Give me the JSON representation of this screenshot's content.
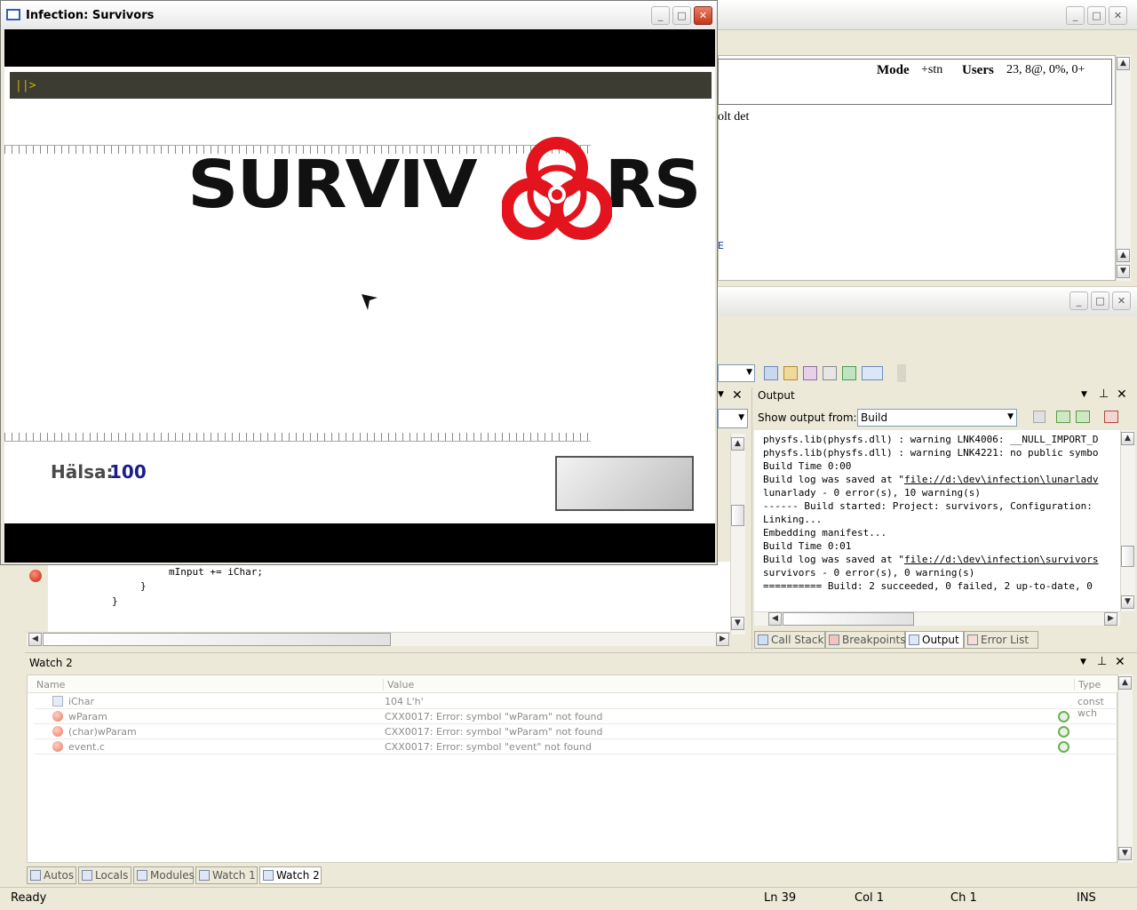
{
  "game_window": {
    "title": "Infection: Survivors",
    "console_prompt": "||>",
    "logo_text": "SURVIV",
    "logo_text_end": "RS",
    "health_label": "Hälsa:",
    "health_value": "100"
  },
  "irc_panel": {
    "mode_label": "Mode",
    "mode_value": "+stn",
    "users_label": "Users",
    "users_value": "23, 8@, 0%, 0+",
    "chat_fragment": "olt det",
    "fragment_2": "E"
  },
  "code_editor": {
    "lines": [
      "mInput += iChar;",
      "}",
      "}"
    ]
  },
  "output_panel": {
    "title": "Output",
    "show_from_label": "Show output from:",
    "show_from_value": "Build",
    "lines": [
      "physfs.lib(physfs.dll) : warning LNK4006: __NULL_IMPORT_D",
      "physfs.lib(physfs.dll) : warning LNK4221: no public symbo",
      "Build Time 0:00",
      "Build log was saved at \"file://d:\\dev\\infection\\lunarladv",
      "lunarlady - 0 error(s), 10 warning(s)",
      "------ Build started: Project: survivors, Configuration:",
      "Linking...",
      "Embedding manifest...",
      "Build Time 0:01",
      "Build log was saved at \"file://d:\\dev\\infection\\survivors",
      "survivors - 0 error(s), 0 warning(s)",
      "========== Build: 2 succeeded, 0 failed, 2 up-to-date, 0"
    ],
    "link_lines": [
      3,
      9
    ],
    "tabs": [
      "Call Stack",
      "Breakpoints",
      "Output",
      "Error List"
    ]
  },
  "watch_panel": {
    "title": "Watch 2",
    "columns": [
      "Name",
      "Value",
      "Type"
    ],
    "rows": [
      {
        "name": "iChar",
        "value": "104 L'h'",
        "type": "const wch",
        "icon": "variable-icon"
      },
      {
        "name": "wParam",
        "value": "CXX0017: Error: symbol \"wParam\" not found",
        "type": "",
        "icon": "error-icon"
      },
      {
        "name": "(char)wParam",
        "value": "CXX0017: Error: symbol \"wParam\" not found",
        "type": "",
        "icon": "error-icon"
      },
      {
        "name": "event.c",
        "value": "CXX0017: Error: symbol \"event\" not found",
        "type": "",
        "icon": "error-icon"
      }
    ],
    "tabs": [
      "Autos",
      "Locals",
      "Modules",
      "Watch 1",
      "Watch 2"
    ]
  },
  "status_bar": {
    "status": "Ready",
    "ln": "Ln 39",
    "col": "Col 1",
    "ch": "Ch 1",
    "mode": "INS"
  }
}
